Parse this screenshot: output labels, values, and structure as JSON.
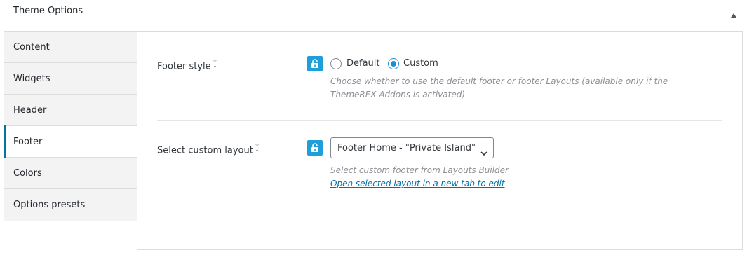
{
  "panel": {
    "title": "Theme Options"
  },
  "tabs": [
    {
      "label": "Content"
    },
    {
      "label": "Widgets"
    },
    {
      "label": "Header"
    },
    {
      "label": "Footer"
    },
    {
      "label": "Colors"
    },
    {
      "label": "Options presets"
    }
  ],
  "active_tab": "Footer",
  "footer_style": {
    "label": "Footer style",
    "required_mark": "*",
    "options": [
      {
        "label": "Default",
        "checked": false
      },
      {
        "label": "Custom",
        "checked": true
      }
    ],
    "description": "Choose whether to use the default footer or footer Layouts (available only if the ThemeREX Addons is activated)"
  },
  "custom_layout": {
    "label": "Select custom layout",
    "required_mark": "*",
    "selected": "Footer Home - \"Private Island\"",
    "description": "Select custom footer from Layouts Builder",
    "link_text": "Open selected layout in a new tab to edit"
  },
  "colors": {
    "accent": "#1e9fd9",
    "link": "#0073aa",
    "active_tab_bar": "#0074a2"
  },
  "icons": [
    "collapse-up-icon",
    "unlock-icon",
    "chevron-down-icon"
  ]
}
